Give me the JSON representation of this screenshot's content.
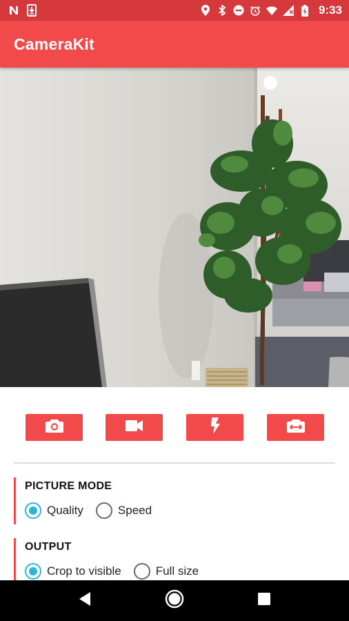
{
  "status_bar": {
    "time": "9:33",
    "left_icons": [
      "n-notification-icon",
      "download-icon"
    ],
    "right_icons": [
      "location-icon",
      "bluetooth-icon",
      "do-not-disturb-icon",
      "alarm-icon",
      "wifi-icon",
      "no-sim-icon",
      "battery-charging-icon"
    ]
  },
  "app_bar": {
    "title": "CameraKit"
  },
  "controls": [
    {
      "name": "capture-photo-button",
      "icon": "camera-icon"
    },
    {
      "name": "capture-video-button",
      "icon": "video-camera-icon"
    },
    {
      "name": "flash-toggle-button",
      "icon": "flash-icon"
    },
    {
      "name": "switch-camera-button",
      "icon": "switch-camera-icon"
    }
  ],
  "picture_mode": {
    "title": "PICTURE MODE",
    "options": [
      {
        "label": "Quality",
        "checked": true
      },
      {
        "label": "Speed",
        "checked": false
      }
    ]
  },
  "output": {
    "title": "OUTPUT",
    "options": [
      {
        "label": "Crop to visible",
        "checked": true
      },
      {
        "label": "Full size",
        "checked": false
      }
    ]
  },
  "colors": {
    "status_bar": "#d6393c",
    "app_bar": "#f2494b",
    "accent": "#29b6d9"
  }
}
